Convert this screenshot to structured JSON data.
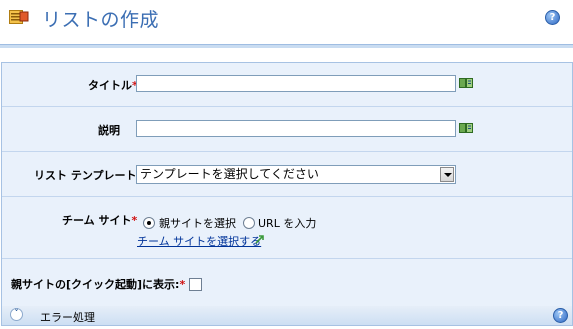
{
  "header": {
    "title": "リストの作成",
    "help_icon": "help-icon",
    "header_icon": "create-list-icon"
  },
  "form": {
    "title_field": {
      "label": "タイトル",
      "required": "*",
      "value": ""
    },
    "description_field": {
      "label": "説明",
      "value": ""
    },
    "template_field": {
      "label": "リスト テンプレート",
      "required": "*",
      "selected": "テンプレートを選択してください"
    },
    "team_site": {
      "label": "チーム サイト",
      "required": "*",
      "option_parent": "親サイトを選択",
      "option_url": "URL を入力",
      "selected": "親サイトを選択",
      "link": "チーム サイトを選択する"
    },
    "quick_launch": {
      "label": "親サイトの[クイック起動]に表示:",
      "required": "*",
      "checked": false
    }
  },
  "footer": {
    "label": "エラー処理"
  },
  "colors": {
    "title": "#3b6eb3",
    "panel_bg": "#e9f1fb",
    "required": "#d01010",
    "link": "#003399"
  }
}
